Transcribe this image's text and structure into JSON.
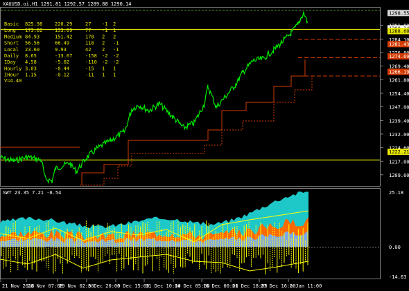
{
  "header": {
    "symbol_line": "XAUUSD.oi,H1  1291.81 1292.57 1289.88 1290.14"
  },
  "stats": {
    "rows": [
      {
        "label": "Basic",
        "v1": "825.98",
        "v2": "220.29",
        "n": "27",
        "a": "-1",
        "b": "2"
      },
      {
        "label": "Long",
        "v1": "173.62",
        "v2": "153.09",
        "n": "77",
        "a": "-1",
        "b": "1"
      },
      {
        "label": "Medium",
        "v1": "84.93",
        "v2": "151.42",
        "n": "178",
        "a": "2",
        "b": "2"
      },
      {
        "label": "Short",
        "v1": "56.56",
        "v2": "66.49",
        "n": "118",
        "a": "2",
        "b": "-1"
      },
      {
        "label": "Local",
        "v1": "23.60",
        "v2": "9.93",
        "n": "42",
        "a": "2",
        "b": "-1"
      },
      {
        "label": "Daily",
        "v1": "8.65",
        "v2": "-13.67",
        "n": "-158",
        "a": "-2",
        "b": "-2"
      },
      {
        "label": "IDay",
        "v1": "4.58",
        "v2": "-5.02",
        "n": "-110",
        "a": "-2",
        "b": "-2"
      },
      {
        "label": "Hourly",
        "v1": "3.03",
        "v2": "-0.44",
        "n": "-15",
        "a": "1",
        "b": "1"
      },
      {
        "label": "IHour",
        "v1": "1.15",
        "v2": "-0.12",
        "n": "-11",
        "a": "1",
        "b": "1"
      }
    ],
    "volatility": "V=4.40"
  },
  "price_axis": {
    "ticks": [
      "1291.80",
      "1284.10",
      "1276.80",
      "1269.40",
      "1261.80",
      "1254.40",
      "1247.00",
      "1239.40",
      "1232.00",
      "1224.60",
      "1217.00",
      "1209.60"
    ],
    "ylim": [
      1205,
      1300
    ],
    "badges": [
      {
        "text": "1298.55",
        "value": 1298.55,
        "bg": "#d8d8d8",
        "fg": "#000000"
      },
      {
        "text": "1290.14",
        "value": 1290.14,
        "bg": "#ffffff",
        "fg": "#000000"
      },
      {
        "text": "1288.60",
        "value": 1288.6,
        "bg": "#e8e800",
        "fg": "#000000"
      },
      {
        "text": "1281.43",
        "value": 1281.43,
        "bg": "#d43a00",
        "fg": "#ffffff"
      },
      {
        "text": "1274.69",
        "value": 1274.69,
        "bg": "#d43a00",
        "fg": "#ffffff"
      },
      {
        "text": "1266.19",
        "value": 1266.19,
        "bg": "#d43a00",
        "fg": "#ffffff"
      },
      {
        "text": "1222.21",
        "value": 1222.21,
        "bg": "#e8e800",
        "fg": "#000000"
      }
    ]
  },
  "indicator": {
    "title": "SWT 23.35 7.21 -0.54",
    "ticks": [
      "25.18",
      "0.00",
      "-14.63"
    ]
  },
  "time_axis": {
    "labels": [
      "21 Nov 2018",
      "26 Nov 07:00",
      "29 Nov 02:00",
      "3 Dec 20:00",
      "6 Dec 15:00",
      "11 Dec 10:00",
      "14 Dec 05:00",
      "16 Dec 00:00",
      "21 Dec 18:00",
      "27 Dec 16:00",
      "2 Jan 11:00"
    ]
  },
  "colors": {
    "price_line": "#00ee00",
    "level_yellow": "#e8e800",
    "level_red": "#d43a00",
    "dashed_green": "#4c8c2c",
    "cyan": "#1ec8c8",
    "orange": "#ff6a00",
    "blue": "#7fa6e8",
    "yellow_bars": "#ffff00",
    "stats_text": "#e8e800"
  }
}
